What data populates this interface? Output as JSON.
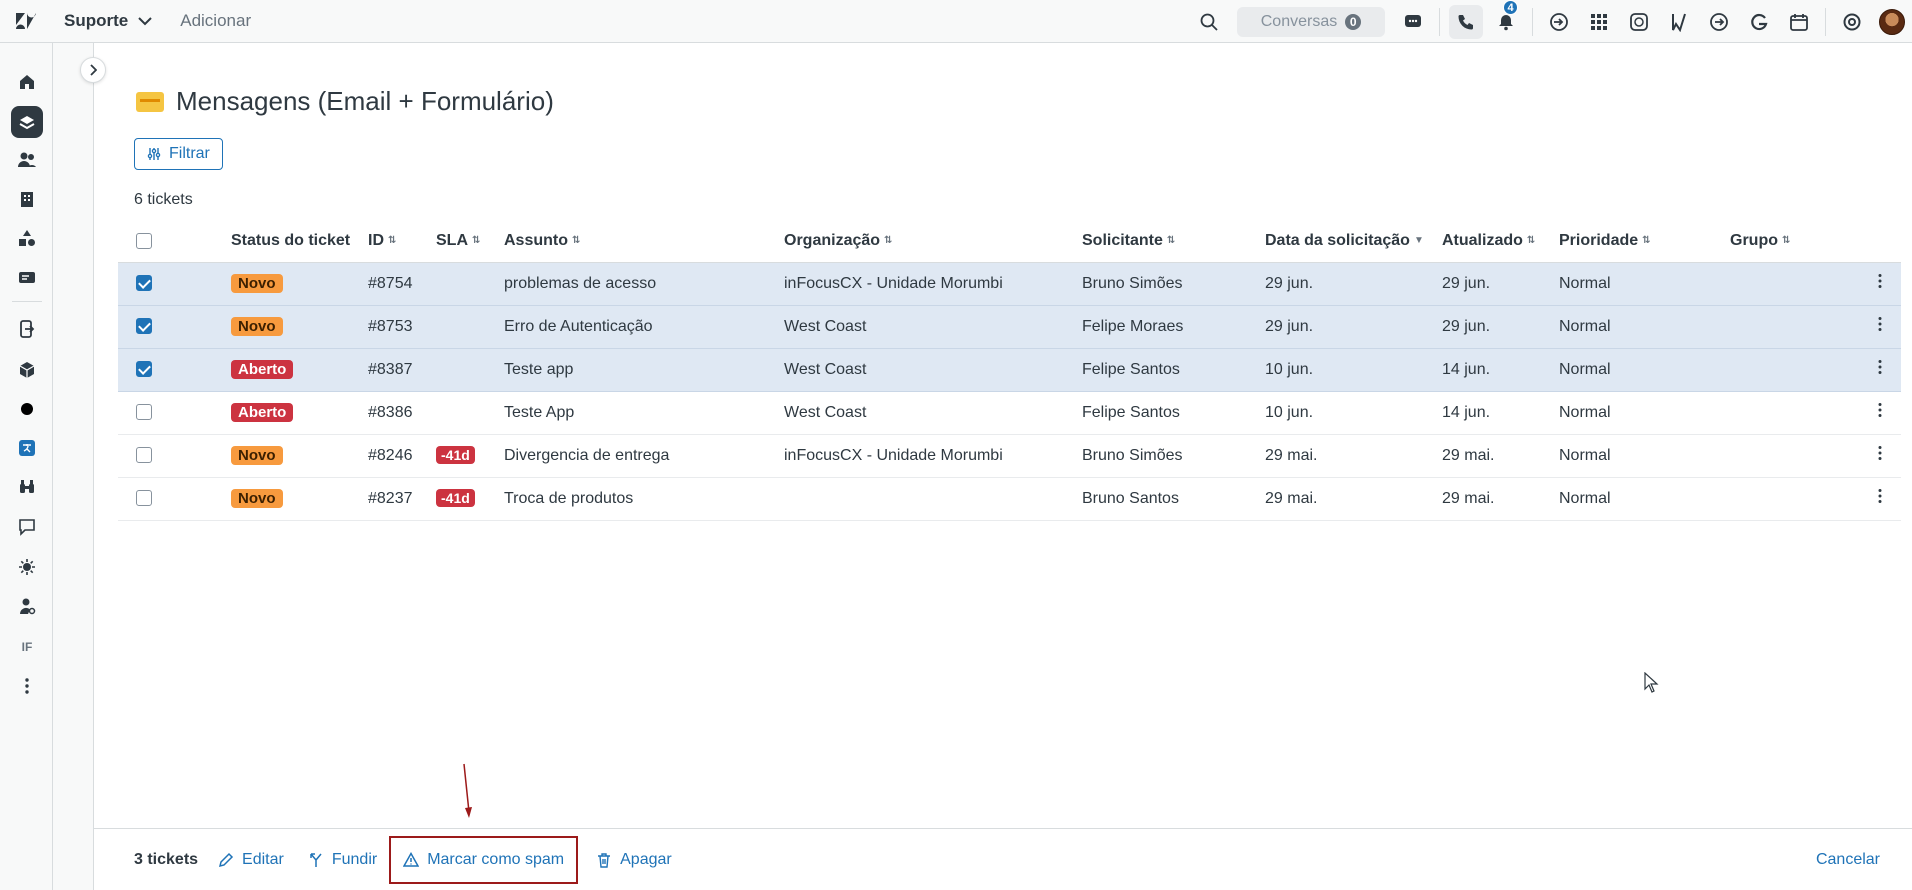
{
  "topbar": {
    "workspace": "Suporte",
    "add_label": "Adicionar",
    "conversations_label": "Conversas",
    "conversations_count": "0",
    "notifications_count": "4",
    "icons": [
      "search-icon",
      "chat-icon",
      "phone-icon",
      "bell-icon",
      "app-icon",
      "grid-icon",
      "whatsapp-icon",
      "bookmark-icon",
      "arrow-icon",
      "g-icon",
      "calendar-icon",
      "help-icon",
      "user-avatar"
    ]
  },
  "page": {
    "title": "Mensagens (Email + Formulário)",
    "filter_label": "Filtrar",
    "ticket_count": "6 tickets"
  },
  "table": {
    "headers": {
      "status": "Status do ticket",
      "id": "ID",
      "sla": "SLA",
      "subject": "Assunto",
      "org": "Organização",
      "requester": "Solicitante",
      "requested": "Data da solicitação",
      "updated": "Atualizado",
      "priority": "Prioridade",
      "group": "Grupo"
    },
    "rows": [
      {
        "checked": true,
        "status": "Novo",
        "status_type": "novo",
        "id": "#8754",
        "sla": "",
        "subject": "problemas de acesso",
        "org": "inFocusCX - Unidade Morumbi",
        "requester": "Bruno Simões",
        "requested": "29 jun.",
        "updated": "29 jun.",
        "priority": "Normal",
        "group": ""
      },
      {
        "checked": true,
        "status": "Novo",
        "status_type": "novo",
        "id": "#8753",
        "sla": "",
        "subject": "Erro de Autenticação",
        "org": "West Coast",
        "requester": "Felipe Moraes",
        "requested": "29 jun.",
        "updated": "29 jun.",
        "priority": "Normal",
        "group": ""
      },
      {
        "checked": true,
        "status": "Aberto",
        "status_type": "aberto",
        "id": "#8387",
        "sla": "",
        "subject": "Teste app",
        "org": "West Coast",
        "requester": "Felipe Santos",
        "requested": "10 jun.",
        "updated": "14 jun.",
        "priority": "Normal",
        "group": ""
      },
      {
        "checked": false,
        "status": "Aberto",
        "status_type": "aberto",
        "id": "#8386",
        "sla": "",
        "subject": "Teste App",
        "org": "West Coast",
        "requester": "Felipe Santos",
        "requested": "10 jun.",
        "updated": "14 jun.",
        "priority": "Normal",
        "group": ""
      },
      {
        "checked": false,
        "status": "Novo",
        "status_type": "novo",
        "id": "#8246",
        "sla": "-41d",
        "subject": "Divergencia de entrega",
        "org": "inFocusCX - Unidade Morumbi",
        "requester": "Bruno Simões",
        "requested": "29 mai.",
        "updated": "29 mai.",
        "priority": "Normal",
        "group": ""
      },
      {
        "checked": false,
        "status": "Novo",
        "status_type": "novo",
        "id": "#8237",
        "sla": "-41d",
        "subject": "Troca de produtos",
        "org": "",
        "requester": "Bruno Santos",
        "requested": "29 mai.",
        "updated": "29 mai.",
        "priority": "Normal",
        "group": ""
      }
    ]
  },
  "bulk_bar": {
    "selected_count": "3 tickets",
    "edit_label": "Editar",
    "merge_label": "Fundir",
    "spam_label": "Marcar como spam",
    "delete_label": "Apagar",
    "cancel_label": "Cancelar"
  },
  "nav": {
    "if_label": "IF"
  },
  "colors": {
    "accent": "#1f73b7",
    "novo": "#f79a3e",
    "aberto": "#cc3340",
    "selected_row": "#dfe8f3",
    "highlight_box": "#9c1a1a"
  }
}
